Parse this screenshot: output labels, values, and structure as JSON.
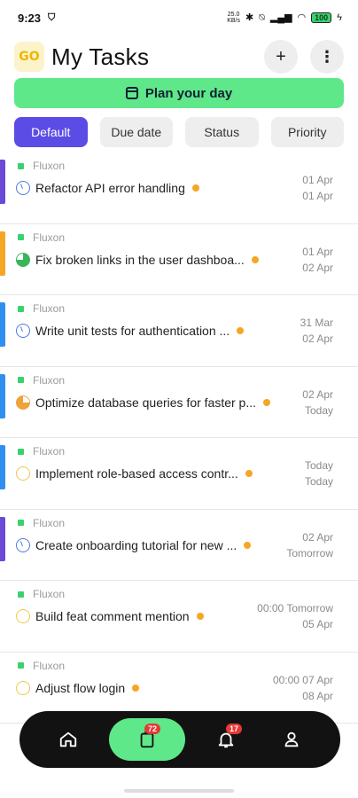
{
  "status_bar": {
    "time": "9:23",
    "network_speed": "25.0\nKB/s",
    "battery": "100"
  },
  "header": {
    "logo_text": "GO",
    "title": "My Tasks",
    "add_label": "+",
    "more_label": "⋮"
  },
  "plan_button": {
    "label": "Plan your day"
  },
  "sort_tabs": [
    {
      "label": "Default"
    },
    {
      "label": "Due date"
    },
    {
      "label": "Status"
    },
    {
      "label": "Priority"
    }
  ],
  "tasks": [
    {
      "project": "Fluxon",
      "name": "Refactor API error handling",
      "start": "01 Apr",
      "end": "01 Apr",
      "bar_color": "#6a4ad6",
      "status": "progress"
    },
    {
      "project": "Fluxon",
      "name": "Fix broken links in the user dashboa...",
      "start": "01 Apr",
      "end": "02 Apr",
      "bar_color": "#f5a623",
      "status": "done"
    },
    {
      "project": "Fluxon",
      "name": "Write unit tests for authentication ...",
      "start": "31 Mar",
      "end": "02 Apr",
      "bar_color": "#2f8ff0",
      "status": "progress"
    },
    {
      "project": "Fluxon",
      "name": "Optimize database queries for faster p...",
      "start": "02 Apr",
      "end": "Today",
      "bar_color": "#2f8ff0",
      "status": "partial"
    },
    {
      "project": "Fluxon",
      "name": "Implement role-based access contr...",
      "start": "Today",
      "end": "Today",
      "bar_color": "#2f8ff0",
      "status": "pending"
    },
    {
      "project": "Fluxon",
      "name": "Create onboarding tutorial for new ...",
      "start": "02 Apr",
      "end": "Tomorrow",
      "bar_color": "#6a4ad6",
      "status": "progress"
    },
    {
      "project": "Fluxon",
      "name": "Build feat comment mention",
      "start": "00:00 Tomorrow",
      "end": "05 Apr",
      "bar_color": "none",
      "status": "pending"
    },
    {
      "project": "Fluxon",
      "name": "Adjust flow login",
      "start": "00:00 07 Apr",
      "end": "08 Apr",
      "bar_color": "none",
      "status": "pending"
    }
  ],
  "bottom_nav": {
    "tasks_badge": "72",
    "notifications_badge": "17"
  },
  "colors": {
    "accent_green": "#5ee88a",
    "active_tab": "#5b4ce6",
    "priority_orange": "#f5a623",
    "nav_bg": "#121212"
  }
}
